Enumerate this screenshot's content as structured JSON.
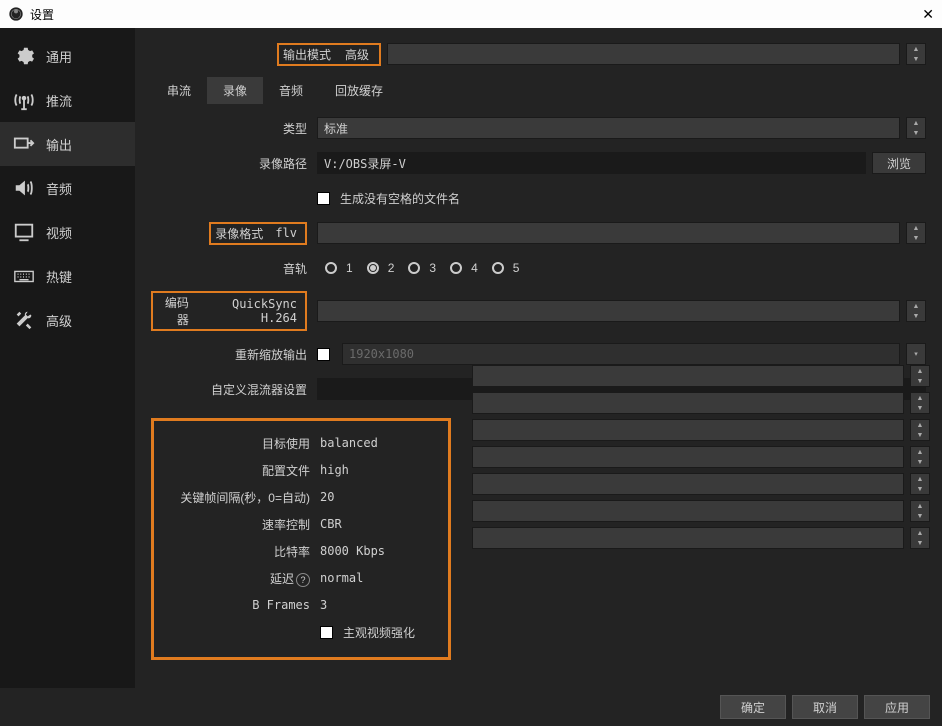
{
  "window": {
    "title": "设置"
  },
  "sidebar": {
    "items": [
      {
        "label": "通用"
      },
      {
        "label": "推流"
      },
      {
        "label": "输出"
      },
      {
        "label": "音频"
      },
      {
        "label": "视频"
      },
      {
        "label": "热键"
      },
      {
        "label": "高级"
      }
    ]
  },
  "output_mode": {
    "label": "输出模式",
    "value": "高级"
  },
  "tabs": [
    {
      "label": "串流"
    },
    {
      "label": "录像"
    },
    {
      "label": "音频"
    },
    {
      "label": "回放缓存"
    }
  ],
  "recording": {
    "type_label": "类型",
    "type_value": "标准",
    "path_label": "录像路径",
    "path_value": "V:/OBS录屏-V",
    "browse": "浏览",
    "nospace_label": "生成没有空格的文件名",
    "format_label": "录像格式",
    "format_value": "flv",
    "tracks_label": "音轨",
    "tracks": [
      "1",
      "2",
      "3",
      "4",
      "5"
    ],
    "encoder_label": "编码器",
    "encoder_value": "QuickSync H.264",
    "rescale_label": "重新缩放输出",
    "rescale_value": "1920x1080",
    "muxer_label": "自定义混流器设置"
  },
  "encoder": {
    "target_label": "目标使用",
    "target_value": "balanced",
    "profile_label": "配置文件",
    "profile_value": "high",
    "keyframe_label": "关键帧间隔(秒，0=自动)",
    "keyframe_value": "20",
    "rate_label": "速率控制",
    "rate_value": "CBR",
    "bitrate_label": "比特率",
    "bitrate_value": "8000 Kbps",
    "latency_label": "延迟",
    "latency_value": "normal",
    "bframes_label": "B Frames",
    "bframes_value": "3",
    "enhance_label": "主观视频强化"
  },
  "footer": {
    "ok": "确定",
    "cancel": "取消",
    "apply": "应用"
  }
}
